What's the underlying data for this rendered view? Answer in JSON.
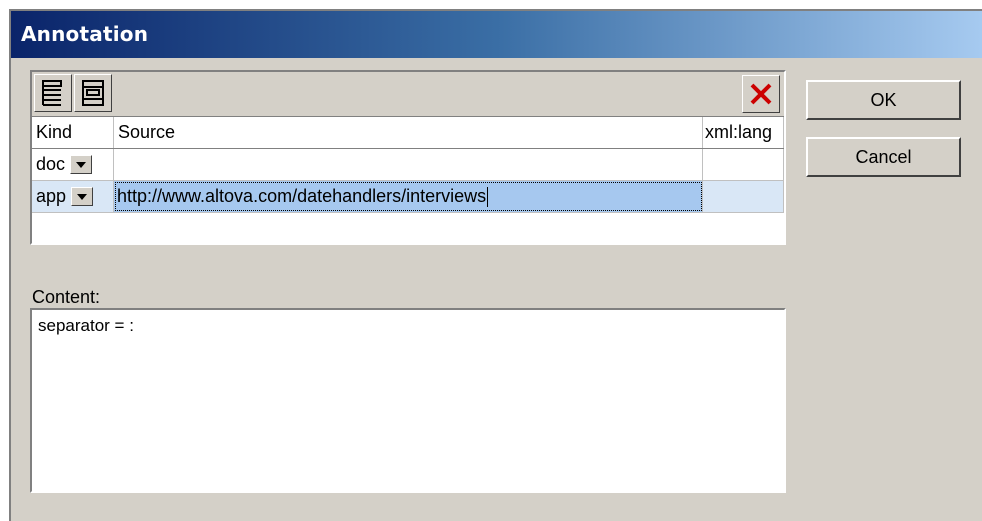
{
  "dialog": {
    "title": "Annotation",
    "ok_label": "OK",
    "cancel_label": "Cancel"
  },
  "toolbar": {
    "icons": [
      "insert-row-icon",
      "append-row-icon",
      "delete-row-icon"
    ],
    "delete_color": "#cc0000"
  },
  "grid": {
    "headers": {
      "kind": "Kind",
      "source": "Source",
      "lang": "xml:lang"
    },
    "rows": [
      {
        "kind": "doc",
        "source": "",
        "lang": ""
      },
      {
        "kind": "app",
        "source": "http://www.altova.com/datehandlers/interviews",
        "lang": ""
      }
    ],
    "selected_row": 1
  },
  "content": {
    "label": "Content:",
    "value": "separator = :"
  },
  "colors": {
    "title_gradient_start": "#0a246a",
    "title_gradient_end": "#a6caf0",
    "dialog_bg": "#d4d0c8",
    "selection": "#a6c8ef"
  }
}
